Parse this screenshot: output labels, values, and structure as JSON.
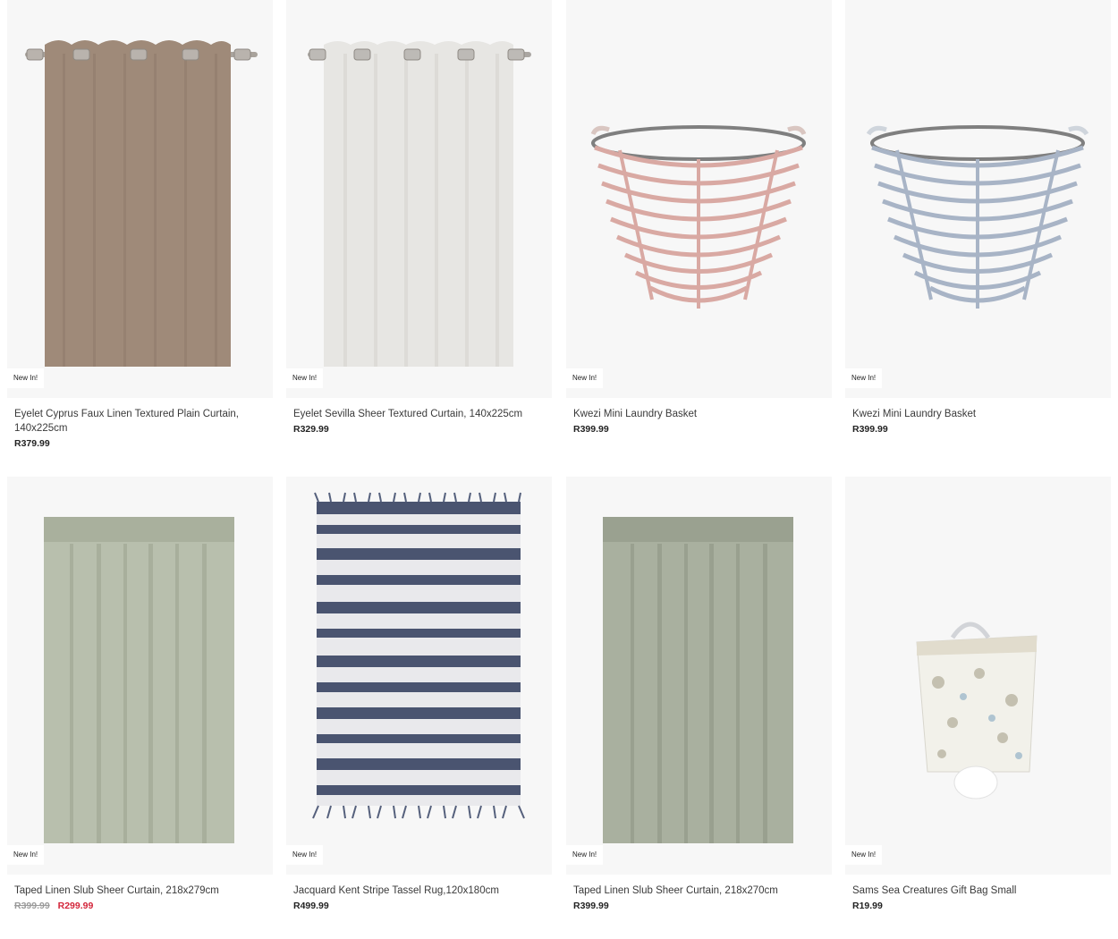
{
  "products": [
    {
      "badge": "New In!",
      "title": "Eyelet Cyprus Faux Linen Textured Plain Curtain, 140x225cm",
      "price": "R379.99",
      "image": "taupe-eyelet-curtain"
    },
    {
      "badge": "New In!",
      "title": "Eyelet Sevilla Sheer Textured Curtain, 140x225cm",
      "price": "R329.99",
      "image": "white-sheer-eyelet-curtain"
    },
    {
      "badge": "New In!",
      "title": "Kwezi Mini Laundry Basket",
      "price": "R399.99",
      "image": "pink-wire-basket"
    },
    {
      "badge": "New In!",
      "title": "Kwezi Mini Laundry Basket",
      "price": "R399.99",
      "image": "blue-wire-basket"
    },
    {
      "badge": "New In!",
      "title": "Taped Linen Slub Sheer Curtain, 218x279cm",
      "old_price": "R399.99",
      "sale_price": "R299.99",
      "image": "sage-taped-curtain"
    },
    {
      "badge": "New In!",
      "title": "Jacquard Kent Stripe Tassel Rug,120x180cm",
      "price": "R499.99",
      "image": "navy-stripe-rug"
    },
    {
      "badge": "New In!",
      "title": "Taped Linen Slub Sheer Curtain, 218x270cm",
      "price": "R399.99",
      "image": "sage-taped-curtain"
    },
    {
      "badge": "New In!",
      "title": "Sams Sea Creatures Gift Bag Small",
      "price": "R19.99",
      "image": "sea-creatures-gift-bag"
    }
  ],
  "colors": {
    "sale": "#d3253a",
    "image_bg": "#f7f7f7"
  }
}
